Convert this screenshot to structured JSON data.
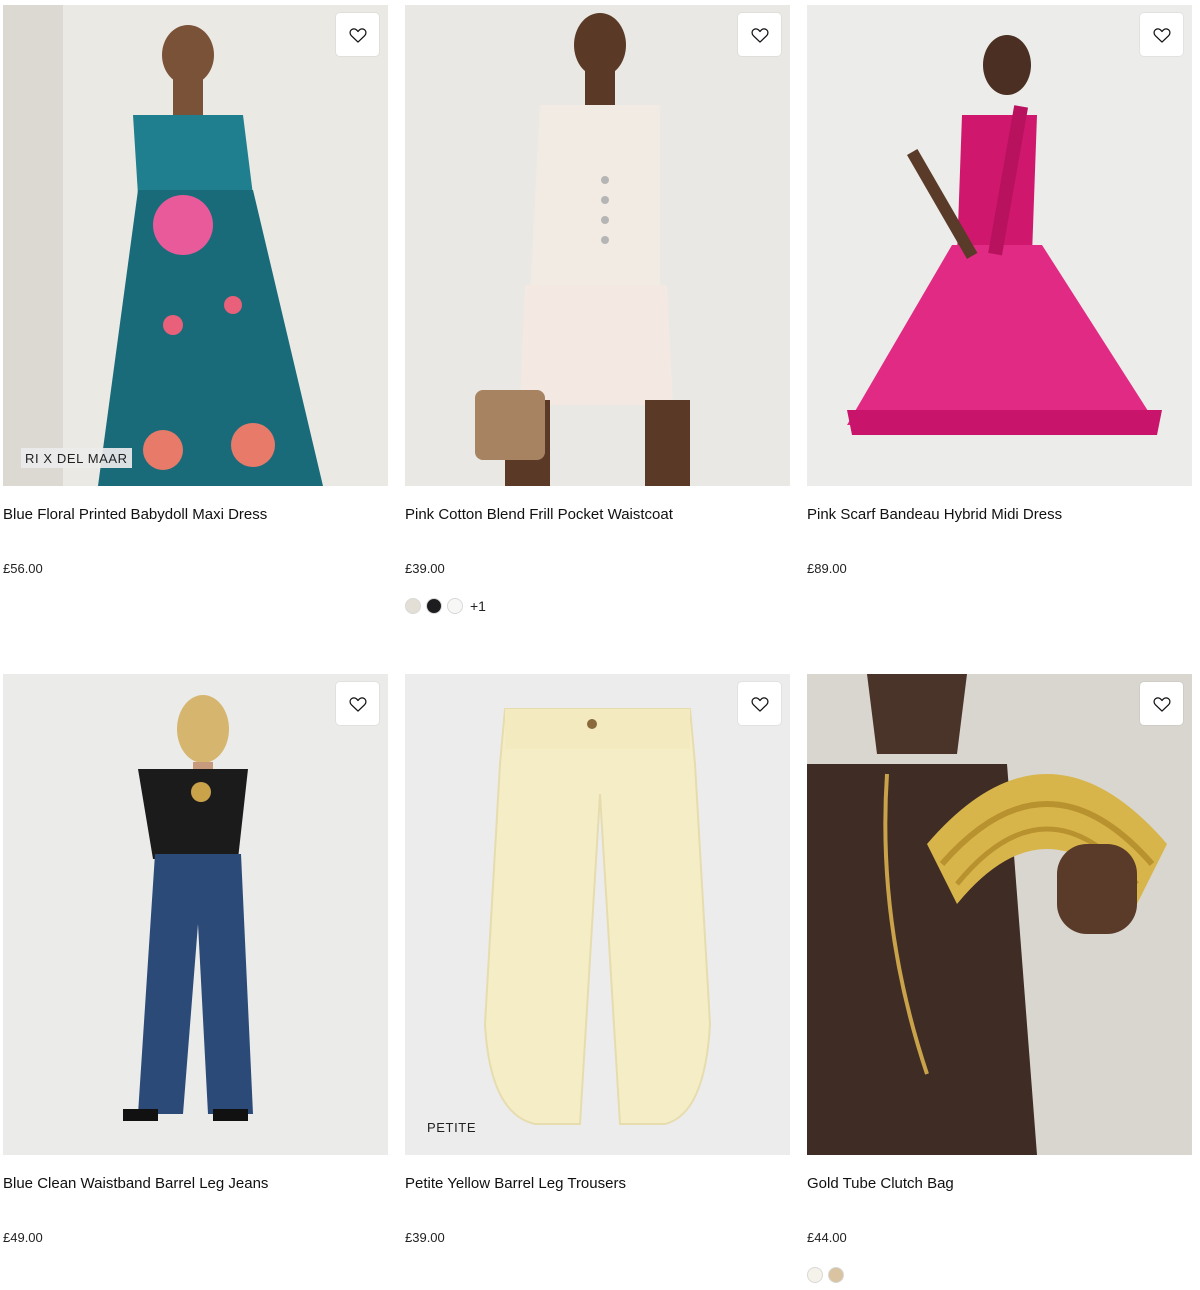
{
  "products": [
    {
      "name": "Blue Floral Printed Babydoll Maxi Dress",
      "price": "£56.00",
      "badge": "RI X DEL MAAR",
      "wishlist_icon": "heart-outline-icon",
      "swatches": [],
      "more": ""
    },
    {
      "name": "Pink Cotton Blend Frill Pocket Waistcoat",
      "price": "£39.00",
      "badge": "",
      "wishlist_icon": "heart-outline-icon",
      "swatches": [
        "#e3dfd6",
        "#1d1d1f",
        "#f7f7f5"
      ],
      "more": "+1"
    },
    {
      "name": "Pink Scarf Bandeau Hybrid Midi Dress",
      "price": "£89.00",
      "badge": "",
      "wishlist_icon": "heart-outline-icon",
      "swatches": [],
      "more": ""
    },
    {
      "name": "Blue Clean Waistband Barrel Leg Jeans",
      "price": "£49.00",
      "badge": "",
      "wishlist_icon": "heart-outline-icon",
      "swatches": [],
      "more": ""
    },
    {
      "name": "Petite Yellow Barrel Leg Trousers",
      "price": "£39.00",
      "badge": "PETITE",
      "wishlist_icon": "heart-outline-icon",
      "swatches": [],
      "more": ""
    },
    {
      "name": "Gold Tube Clutch Bag",
      "price": "£44.00",
      "badge": "",
      "wishlist_icon": "heart-outline-icon",
      "swatches": [
        "#f5f2ea",
        "#d9c3a0"
      ],
      "more": ""
    }
  ]
}
